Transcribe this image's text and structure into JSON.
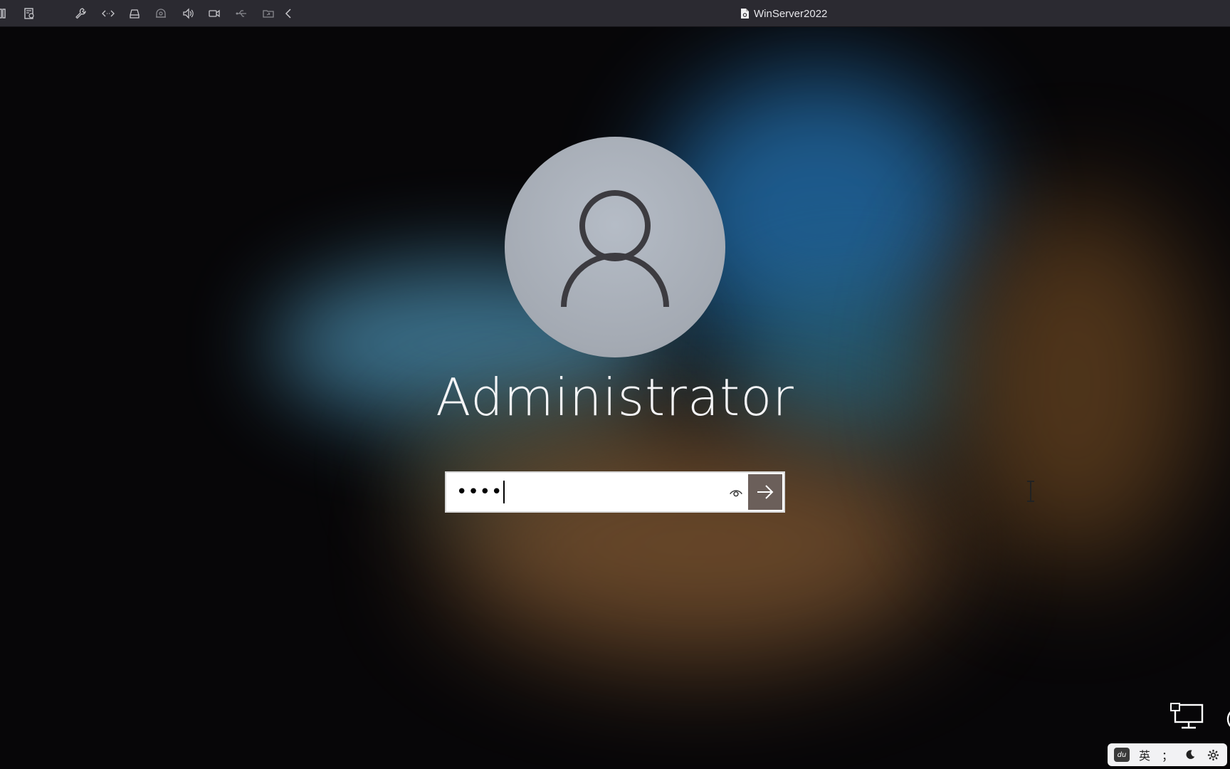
{
  "toolbar": {
    "title": "WinServer2022",
    "buttons": [
      {
        "name": "sidebar-toggle-icon"
      },
      {
        "name": "vm-settings-icon"
      },
      {
        "name": "wrench-icon"
      },
      {
        "name": "code-arrows-icon"
      },
      {
        "name": "drive-icon"
      },
      {
        "name": "camera-dome-icon"
      },
      {
        "name": "speaker-icon"
      },
      {
        "name": "video-camera-icon"
      },
      {
        "name": "usb-icon"
      },
      {
        "name": "shared-folder-icon"
      },
      {
        "name": "chevron-left-icon"
      }
    ]
  },
  "login": {
    "username": "Administrator",
    "password_value": "••••",
    "submit_button": "arrow-right-icon",
    "reveal_button": "eye-icon"
  },
  "tray": {
    "network_icon": "network-icon",
    "accessibility_icon": "accessibility-icon"
  },
  "ime": {
    "logo": "du",
    "lang": "英",
    "punct": "；",
    "mode_icon": "moon-icon",
    "settings_icon": "gear-icon"
  },
  "colors": {
    "toolbar_bg": "#2b2a31",
    "submit_bg": "#6b5f5a",
    "avatar_bg": "#a8aeb7"
  }
}
